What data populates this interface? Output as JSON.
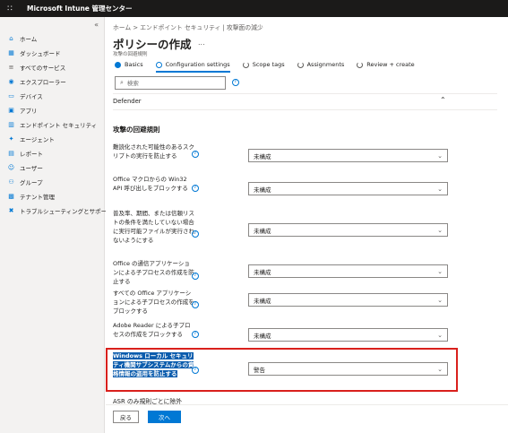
{
  "app": {
    "title": "Microsoft Intune 管理センター"
  },
  "sidebar": {
    "items": [
      {
        "label": "ホーム",
        "icon": "home-icon"
      },
      {
        "label": "ダッシュボード",
        "icon": "dashboard-icon"
      },
      {
        "label": "すべてのサービス",
        "icon": "all-services-icon"
      },
      {
        "label": "エクスプローラー",
        "icon": "explorer-icon"
      },
      {
        "label": "デバイス",
        "icon": "devices-icon"
      },
      {
        "label": "アプリ",
        "icon": "apps-icon"
      },
      {
        "label": "エンドポイント セキュリティ",
        "icon": "endpoint-security-icon"
      },
      {
        "label": "エージェント",
        "icon": "agents-icon"
      },
      {
        "label": "レポート",
        "icon": "reports-icon"
      },
      {
        "label": "ユーザー",
        "icon": "users-icon"
      },
      {
        "label": "グループ",
        "icon": "groups-icon"
      },
      {
        "label": "テナント管理",
        "icon": "tenant-admin-icon"
      },
      {
        "label": "トラブルシューティングとサポート",
        "icon": "troubleshooting-icon"
      }
    ]
  },
  "breadcrumb": "ホーム > エンドポイント セキュリティ | 攻撃面の減少",
  "page": {
    "title": "ポリシーの作成",
    "more": "...",
    "subtitle": "攻撃の回避規則"
  },
  "tabs": [
    {
      "label": "Basics",
      "state": "done"
    },
    {
      "label": "Configuration settings",
      "state": "current"
    },
    {
      "label": "Scope tags",
      "state": "todo"
    },
    {
      "label": "Assignments",
      "state": "todo"
    },
    {
      "label": "Review + create",
      "state": "todo"
    }
  ],
  "search": {
    "placeholder": "検索",
    "value": ""
  },
  "section": {
    "header": "Defender"
  },
  "group_title": "攻撃の回避規則",
  "rules": [
    {
      "label": "難読化された可能性のあるスクリプトの実行を防止する",
      "value": "未構成"
    },
    {
      "label": "Office マクロからの Win32 API 呼び出しをブロックする",
      "value": "未構成"
    },
    {
      "label": "普及率、期間、または信頼リストの条件を満たしていない場合に実行可能ファイルが実行されないようにする",
      "value": "未構成"
    },
    {
      "label": "Office の通信アプリケーションによる子プロセスの作成を防止する",
      "value": "未構成"
    },
    {
      "label": "すべての Office アプリケーションによる子プロセスの作成をブロックする",
      "value": "未構成"
    },
    {
      "label": "Adobe Reader による子プロセスの作成をブロックする",
      "value": "未構成"
    },
    {
      "label": "Windows ローカル セキュリティ機関サブシステムからの資格情報の盗用を防止する",
      "value": "警告"
    }
  ],
  "asr_label": "ASR のみ規則ごとに除外",
  "footer": {
    "back": "戻る",
    "next": "次へ"
  },
  "colors": {
    "accent": "#0078d4",
    "highlight": "#d9201c",
    "topbar": "#1b1a19",
    "selection": "#0b5cad"
  }
}
